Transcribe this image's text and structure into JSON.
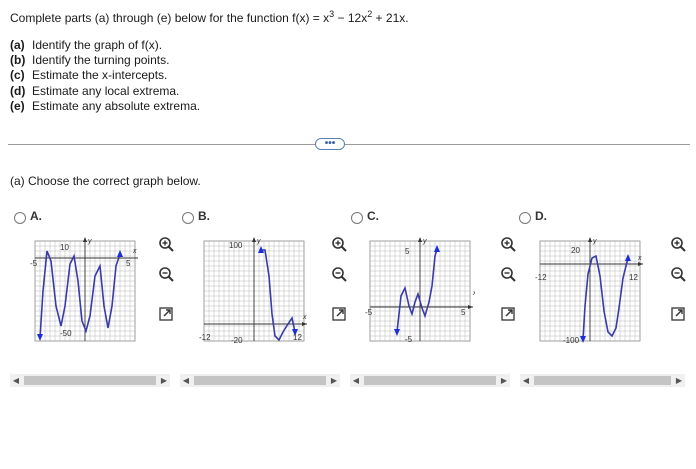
{
  "problem": {
    "prefix": "Complete parts (a) through (e) below for the function f(x) = x",
    "exp1": "3",
    "mid": " − 12x",
    "exp2": "2",
    "suffix": " + 21x."
  },
  "parts": [
    {
      "letter": "(a)",
      "text": "Identify the graph of f(x)."
    },
    {
      "letter": "(b)",
      "text": "Identify the turning points."
    },
    {
      "letter": "(c)",
      "text": "Estimate the x-intercepts."
    },
    {
      "letter": "(d)",
      "text": "Estimate any local extrema."
    },
    {
      "letter": "(e)",
      "text": "Estimate any absolute extrema."
    }
  ],
  "more_button": "•••",
  "question": "(a) Choose the correct graph below.",
  "options": [
    {
      "label": "A.",
      "y_top": "10",
      "y_bottom": "-50",
      "x_left": "-5",
      "x_right": "5",
      "x_axis": "x",
      "y_axis": "y"
    },
    {
      "label": "B.",
      "y_top": "100",
      "y_bottom": "-20",
      "x_left": "-12",
      "x_right": "12",
      "x_axis": "x",
      "y_axis": "y"
    },
    {
      "label": "C.",
      "y_top": "5",
      "y_bottom": "-5",
      "x_left": "-5",
      "x_right": "5",
      "x_axis": "x",
      "y_axis": "y"
    },
    {
      "label": "D.",
      "y_top": "20",
      "y_bottom": "-100",
      "x_left": "-12",
      "x_right": "12",
      "x_axis": "x",
      "y_axis": "y"
    }
  ],
  "icons": [
    "zoom-in-icon",
    "zoom-out-icon",
    "expand-icon"
  ],
  "colors": {
    "curve": "#3a3aa8",
    "arrow": "#1a2fd6",
    "grid": "#b0b0b0",
    "link": "#3560a8"
  }
}
